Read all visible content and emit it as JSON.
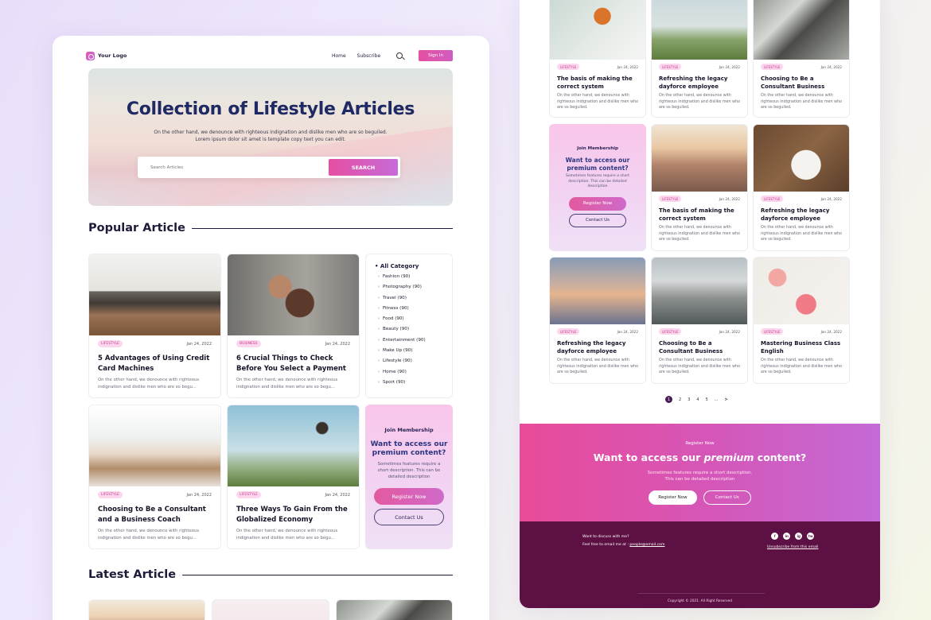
{
  "nav": {
    "logo": "Your Logo",
    "links": [
      "Home",
      "Subscribe"
    ],
    "signin": "Sign In"
  },
  "hero": {
    "title": "Collection of Lifestyle Articles",
    "desc_line1": "On the other hand, we denounce with righteous indignation and dislike men who are so beguiled.",
    "desc_line2": "Lorem ipsum dolor sit amet is template copy text you can edit.",
    "search_placeholder": "Search Articles",
    "search_button": "SEARCH"
  },
  "popular": {
    "heading": "Popular Article"
  },
  "latest": {
    "heading": "Latest Article"
  },
  "desc": "On the other hand, we denounce with righteous indignation and dislike men who are so begu...",
  "rdesc": "On the other hand, we denounce with righteous indignation and dislike men who are so beguiled.",
  "cards": [
    {
      "tag": "LIFESTYLE",
      "date": "Jan 24, 2022",
      "title": "5 Advantages of Using Credit Card Machines"
    },
    {
      "tag": "BUSINESS",
      "date": "Jan 24, 2022",
      "title": "6 Crucial Things to Check Before You Select a Payment"
    },
    {
      "tag": "LIFESTYLE",
      "date": "Jan 24, 2022",
      "title": "Choosing to Be a Consultant and a Business Coach"
    },
    {
      "tag": "LIFESTYLE",
      "date": "Jan 24, 2022",
      "title": "Three Ways To Gain From the Globalized Economy"
    }
  ],
  "categories": {
    "heading": "All Category",
    "items": [
      "Fashion (90)",
      "Photography (90)",
      "Travel (90)",
      "Fitness (90)",
      "Food (90)",
      "Beauty (90)",
      "Entertainment (90)",
      "Make Up (90)",
      "Lifestyle (90)",
      "Home (90)",
      "Sport (90)"
    ]
  },
  "join": {
    "heading": "Join Membership",
    "title": "Want to access our premium content?",
    "desc": "Sometimes features require a short description. This can be detailed description",
    "register": "Register Now",
    "contact": "Contact Us"
  },
  "rcards": [
    {
      "tag": "LIFESTYLE",
      "date": "Jan 24, 2022",
      "title": "The basis of making the correct system"
    },
    {
      "tag": "LIFESTYLE",
      "date": "Jan 24, 2022",
      "title": "Refreshing the legacy dayforce employee"
    },
    {
      "tag": "LIFESTYLE",
      "date": "Jan 24, 2022",
      "title": "Choosing to Be a Consultant Business"
    },
    {
      "tag": "LIFESTYLE",
      "date": "Jan 24, 2022",
      "title": "The basis of making the correct system"
    },
    {
      "tag": "LIFESTYLE",
      "date": "Jan 24, 2022",
      "title": "Refreshing the legacy dayforce employee"
    },
    {
      "tag": "LIFESTYLE",
      "date": "Jan 24, 2022",
      "title": "Refreshing the legacy dayforce employee"
    },
    {
      "tag": "LIFESTYLE",
      "date": "Jan 24, 2022",
      "title": "Choosing to Be a Consultant Business"
    },
    {
      "tag": "LIFESTYLE",
      "date": "Jan 24, 2022",
      "title": "Mastering Business Class English"
    }
  ],
  "pagination": {
    "pages": [
      "1",
      "2",
      "3",
      "4",
      "5",
      "...",
      ">"
    ]
  },
  "cta": {
    "heading": "Register Now",
    "title_pre": "Want to access our ",
    "title_em": "premium",
    "title_post": " content?",
    "desc_line1": "Sometimes features require a short description.",
    "desc_line2": "This can be detailed description",
    "register": "Register Now",
    "contact": "Contact Us"
  },
  "footer": {
    "discuss": "Want to discuss with me?",
    "email_pre": "Feel free to email me at : ",
    "email": "people@email.com",
    "unsubscribe": "Unsubscribe from this email",
    "copyright": "Copyright © 2021. All Right Reserved",
    "socials": [
      "f",
      "in",
      "ig",
      "tw"
    ]
  },
  "colors": {
    "accent": "#e450a3",
    "navy": "#1f2a64",
    "footer": "#5d1043"
  }
}
